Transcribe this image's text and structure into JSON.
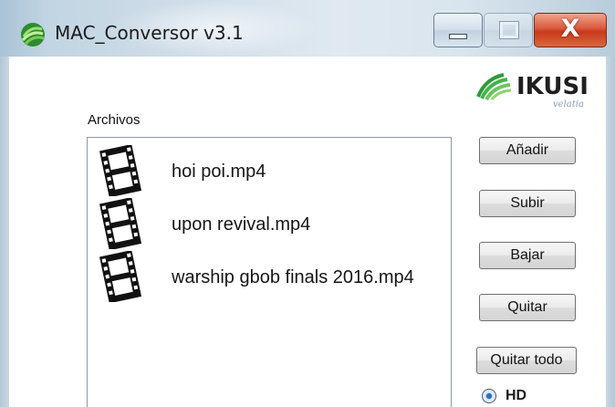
{
  "window": {
    "title": "MAC_Conversor v3.1",
    "controls": {
      "minimize_icon": "minimize-icon",
      "maximize_icon": "maximize-icon",
      "close_icon": "close-icon",
      "close_glyph": "X"
    }
  },
  "logo": {
    "brand": "IKUSI",
    "sub": "velatia"
  },
  "files": {
    "label": "Archivos",
    "items": [
      {
        "name": "hoi poi.mp4",
        "icon": "film-icon"
      },
      {
        "name": "upon revival.mp4",
        "icon": "film-icon"
      },
      {
        "name": "warship gbob finals 2016.mp4",
        "icon": "film-icon"
      }
    ]
  },
  "actions": {
    "add": "Añadir",
    "up": "Subir",
    "down": "Bajar",
    "remove": "Quitar",
    "remove_all": "Quitar todo"
  },
  "quality": {
    "option_hd": "HD",
    "hd_selected": true
  },
  "colors": {
    "close_button": "#d9593a",
    "radio_selected": "#2f6fc2",
    "titlebar": "#cfdde8"
  }
}
